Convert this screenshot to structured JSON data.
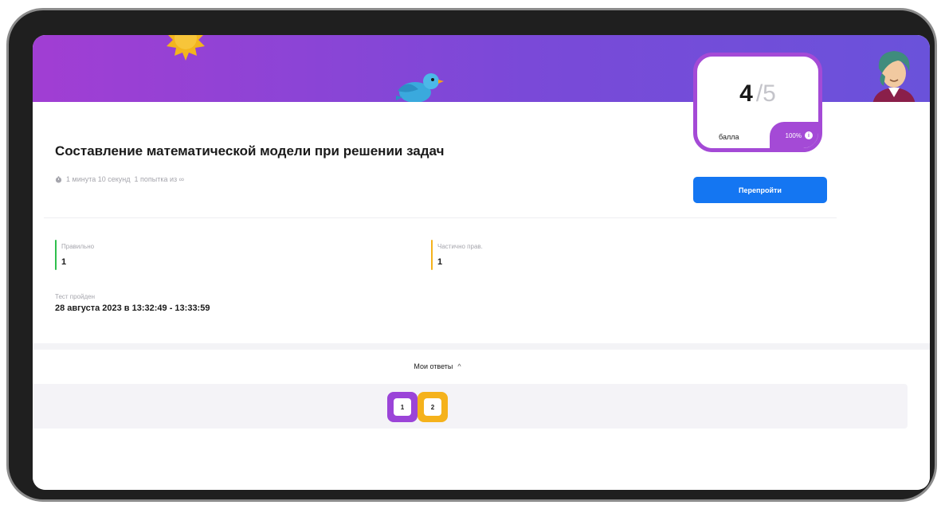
{
  "test": {
    "title": "Составление математической модели при решении задач",
    "duration": "1 минута 10 секунд",
    "attempts": "1 попытка из ∞"
  },
  "score": {
    "value": "4",
    "max": "/5",
    "unit": "балла",
    "percent": "100%",
    "info_glyph": "i"
  },
  "actions": {
    "retake_label": "Перепройти"
  },
  "stats": {
    "correct_label": "Правильно",
    "correct_value": "1",
    "partial_label": "Частично прав.",
    "partial_value": "1",
    "correct_color": "#2fbf4d",
    "partial_color": "#f5b21c"
  },
  "completion": {
    "label": "Тест пройден",
    "value": "28 августа 2023 в 13:32:49 - 13:33:59"
  },
  "answers": {
    "toggle_label": "Мои ответы",
    "toggle_glyph": "^",
    "items": [
      {
        "label": "1",
        "color": "#9b44d8"
      },
      {
        "label": "2",
        "color": "#f5b21c"
      }
    ]
  },
  "theme": {
    "banner_start": "#a13ed3",
    "banner_end": "#6a52da",
    "accent": "#a44ad6",
    "button": "#1476f2"
  }
}
